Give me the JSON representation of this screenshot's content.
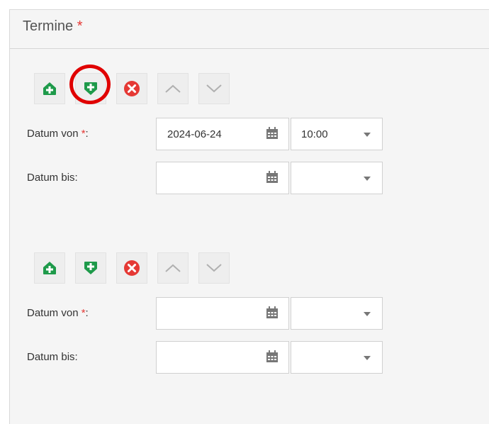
{
  "section": {
    "title": "Termine",
    "required_mark": "*"
  },
  "toolbar_icons": [
    "add-above-icon",
    "add-below-icon",
    "delete-icon",
    "move-up-icon",
    "move-down-icon"
  ],
  "colors": {
    "green": "#1e9a4a",
    "red": "#e53935",
    "highlight": "#e00000"
  },
  "groups": [
    {
      "date_from": {
        "label": "Datum von ",
        "required_mark": "*",
        "label_suffix": ":",
        "date": "2024-06-24",
        "time": "10:00"
      },
      "date_to": {
        "label": "Datum bis:",
        "date": "",
        "time": ""
      }
    },
    {
      "date_from": {
        "label": "Datum von ",
        "required_mark": "*",
        "label_suffix": ":",
        "date": "",
        "time": ""
      },
      "date_to": {
        "label": "Datum bis:",
        "date": "",
        "time": ""
      }
    }
  ]
}
